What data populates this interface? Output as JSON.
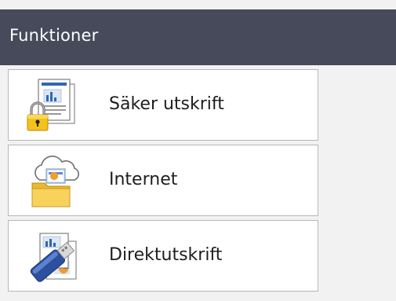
{
  "header": {
    "title": "Funktioner"
  },
  "menu": {
    "items": [
      {
        "label": "Säker utskrift",
        "icon": "secure-print-icon"
      },
      {
        "label": "Internet",
        "icon": "internet-folder-icon"
      },
      {
        "label": "Direktutskrift",
        "icon": "usb-direct-print-icon"
      }
    ]
  },
  "colors": {
    "header_bg": "#464a5b",
    "page_bg": "#f2f2f2",
    "item_border": "#b7b7b7"
  }
}
